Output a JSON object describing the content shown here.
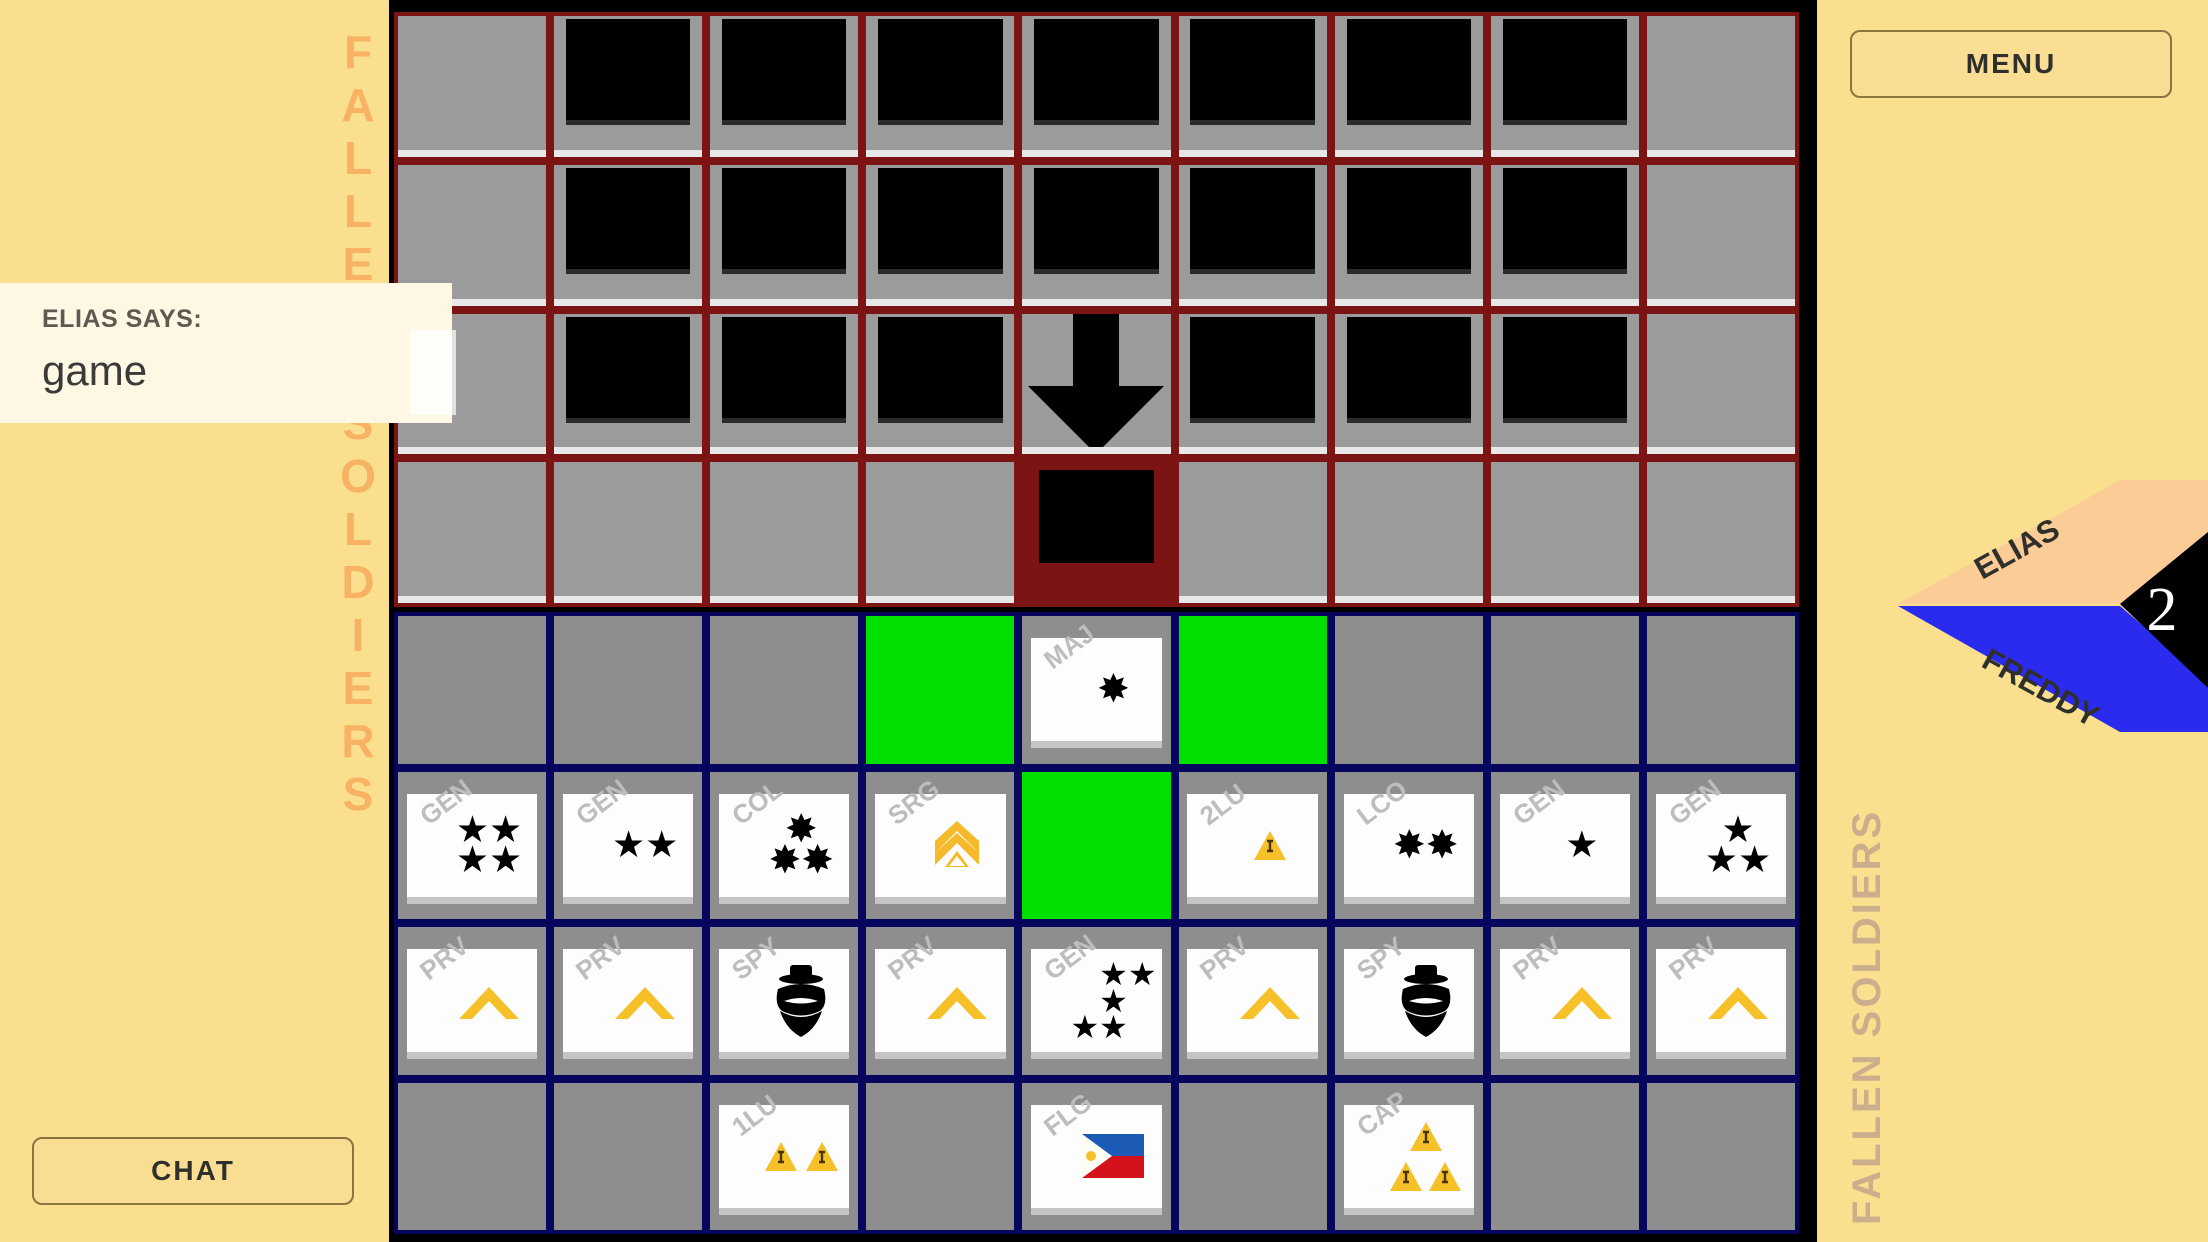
{
  "left_panel": {
    "vertical_label": "FALLEN SOLDIERS",
    "chat": {
      "header": "ELIAS SAYS:",
      "message": "game"
    },
    "chat_button_label": "CHAT"
  },
  "right_panel": {
    "menu_button_label": "MENU",
    "vertical_label": "FALLEN SOLDIERS",
    "turn_banner": {
      "player_top": "ELIAS",
      "player_bottom": "FREDDY",
      "counter": "2",
      "color_top": "#fbcc96",
      "color_bottom": "#2b2bf0",
      "color_wedge": "#000000"
    }
  },
  "colors": {
    "background": "#fadf8e",
    "fallen_border": "#7d1414",
    "play_border": "#06065e",
    "cell_empty": "#8e8e8e",
    "move_highlight": "#00e000",
    "vertical_label_left": "#f7b263",
    "vertical_label_right": "#cbae8b"
  },
  "fallen_grid": {
    "columns": 9,
    "rows": 4,
    "cells": [
      {
        "type": "blank"
      },
      {
        "type": "card"
      },
      {
        "type": "card"
      },
      {
        "type": "card"
      },
      {
        "type": "card"
      },
      {
        "type": "card"
      },
      {
        "type": "card"
      },
      {
        "type": "card"
      },
      {
        "type": "blank"
      },
      {
        "type": "blank"
      },
      {
        "type": "card"
      },
      {
        "type": "card"
      },
      {
        "type": "card"
      },
      {
        "type": "card"
      },
      {
        "type": "card"
      },
      {
        "type": "card"
      },
      {
        "type": "card"
      },
      {
        "type": "blank"
      },
      {
        "type": "blank"
      },
      {
        "type": "card"
      },
      {
        "type": "card"
      },
      {
        "type": "card"
      },
      {
        "type": "arrow",
        "icon": "arrow-down-icon"
      },
      {
        "type": "card"
      },
      {
        "type": "card"
      },
      {
        "type": "card"
      },
      {
        "type": "blank"
      },
      {
        "type": "blank"
      },
      {
        "type": "blank"
      },
      {
        "type": "blank"
      },
      {
        "type": "blank"
      },
      {
        "type": "highlight-card"
      },
      {
        "type": "blank"
      },
      {
        "type": "blank"
      },
      {
        "type": "blank"
      },
      {
        "type": "blank"
      }
    ]
  },
  "play_grid": {
    "columns": 9,
    "rows": 4,
    "cells": [
      {
        "type": "empty"
      },
      {
        "type": "empty"
      },
      {
        "type": "empty"
      },
      {
        "type": "move"
      },
      {
        "type": "piece",
        "rank": "MAJ",
        "insignia": "flower",
        "count": 1
      },
      {
        "type": "move"
      },
      {
        "type": "empty"
      },
      {
        "type": "empty"
      },
      {
        "type": "empty"
      },
      {
        "type": "piece",
        "rank": "GEN",
        "insignia": "star",
        "count": 4
      },
      {
        "type": "piece",
        "rank": "GEN",
        "insignia": "star",
        "count": 2
      },
      {
        "type": "piece",
        "rank": "COL",
        "insignia": "flower",
        "count": 3
      },
      {
        "type": "piece",
        "rank": "SRG",
        "insignia": "chevron-sergeant",
        "count": 1
      },
      {
        "type": "move"
      },
      {
        "type": "piece",
        "rank": "2LU",
        "insignia": "triangle",
        "count": 1
      },
      {
        "type": "piece",
        "rank": "LCO",
        "insignia": "flower",
        "count": 2
      },
      {
        "type": "piece",
        "rank": "GEN",
        "insignia": "star",
        "count": 1
      },
      {
        "type": "piece",
        "rank": "GEN",
        "insignia": "star",
        "count": 3
      },
      {
        "type": "piece",
        "rank": "PRV",
        "insignia": "chevron",
        "count": 1
      },
      {
        "type": "piece",
        "rank": "PRV",
        "insignia": "chevron",
        "count": 1
      },
      {
        "type": "piece",
        "rank": "SPY",
        "insignia": "spy",
        "count": 1
      },
      {
        "type": "piece",
        "rank": "PRV",
        "insignia": "chevron",
        "count": 1
      },
      {
        "type": "piece",
        "rank": "GEN",
        "insignia": "star",
        "count": 5
      },
      {
        "type": "piece",
        "rank": "PRV",
        "insignia": "chevron",
        "count": 1
      },
      {
        "type": "piece",
        "rank": "SPY",
        "insignia": "spy",
        "count": 1
      },
      {
        "type": "piece",
        "rank": "PRV",
        "insignia": "chevron",
        "count": 1
      },
      {
        "type": "piece",
        "rank": "PRV",
        "insignia": "chevron",
        "count": 1
      },
      {
        "type": "empty"
      },
      {
        "type": "empty"
      },
      {
        "type": "piece",
        "rank": "1LU",
        "insignia": "triangle",
        "count": 2
      },
      {
        "type": "empty"
      },
      {
        "type": "piece",
        "rank": "FLG",
        "insignia": "flag-philippines",
        "count": 1
      },
      {
        "type": "empty"
      },
      {
        "type": "piece",
        "rank": "CAP",
        "insignia": "triangle",
        "count": 3
      },
      {
        "type": "empty"
      },
      {
        "type": "empty"
      }
    ]
  }
}
